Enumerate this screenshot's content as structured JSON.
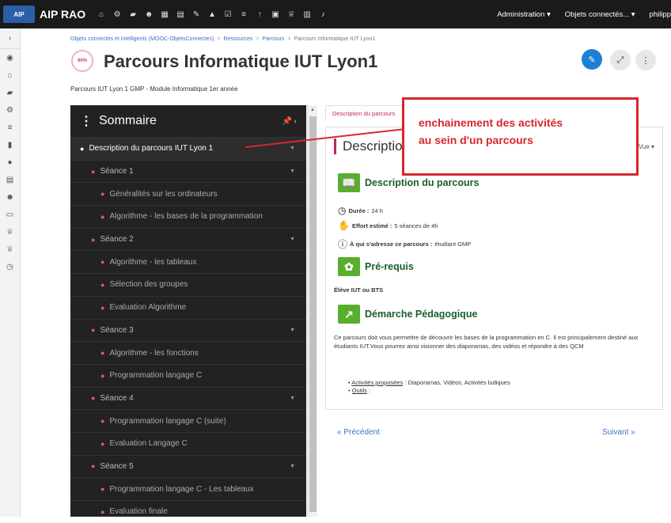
{
  "topbar": {
    "logo_text": "AIP",
    "app_title": "AIP RAO",
    "icons": [
      "home-icon",
      "gear-icon",
      "folder-icon",
      "users-icon",
      "grid-icon",
      "calendar-icon",
      "edit-icon",
      "warning-icon",
      "check-icon",
      "list-icon",
      "up-icon",
      "table-icon",
      "trophy-icon",
      "db-icon",
      "bell-icon"
    ],
    "menu_admin": "Administration ▾",
    "menu_objets": "Objets connectés... ▾",
    "menu_user": "philipp"
  },
  "breadcrumb": {
    "items": [
      "Objets connectés et intelligents (MOOC-ObjetsConnectes)",
      "Ressources",
      "Parcours",
      "Parcours Informatique IUT Lyon1"
    ]
  },
  "header": {
    "progress": "90%",
    "title": "Parcours Informatique IUT Lyon1",
    "subtitle": "Parcours IUT Lyon 1  GMP - Module Informatique 1er année"
  },
  "sommaire": {
    "title": "Sommaire",
    "items": [
      {
        "label": "Description du parcours IUT Lyon 1",
        "level": 0
      },
      {
        "label": "Séance 1",
        "level": 1
      },
      {
        "label": "Généralités sur les ordinateurs",
        "level": 2
      },
      {
        "label": "Algorithme - les bases de la programmation",
        "level": 2
      },
      {
        "label": "Séance 2",
        "level": 1
      },
      {
        "label": "Algorithme - les tableaux",
        "level": 2
      },
      {
        "label": "Sélection des groupes",
        "level": 2
      },
      {
        "label": "Evaluation Algorithme",
        "level": 2
      },
      {
        "label": "Séance 3",
        "level": 1
      },
      {
        "label": "Algorithme - les fonctions",
        "level": 2
      },
      {
        "label": "Programmation langage C",
        "level": 2
      },
      {
        "label": "Séance 4",
        "level": 1
      },
      {
        "label": "Programmation langage C (suite)",
        "level": 2
      },
      {
        "label": "Evaluation Langage C",
        "level": 2
      },
      {
        "label": "Séance 5",
        "level": 1
      },
      {
        "label": "Programmation langage C - Les tableaux",
        "level": 2
      },
      {
        "label": "Evaluation finale",
        "level": 2
      }
    ]
  },
  "content": {
    "tab_label": "Description du parcours",
    "title": "Descriptio",
    "vue": "Vue ▾",
    "section1": "Description du parcours",
    "duree_label": "Durée :",
    "duree_value": "24 h",
    "effort_label": "Effort estimé :",
    "effort_value": "5 séances de 4h",
    "public_label": "À qui s'adresse ce parcours :",
    "public_value": "étudiant GMP",
    "section2": "Pré-requis",
    "prerequis": "Élève IUT ou BTS",
    "section3": "Démarche Pédagogique",
    "paragraph": "Ce parcours doit vous permettre de découvrir les bases de la programmation en C. Il est principalement destiné aux étudiants IUT.Vous pourrez ainsi visionner des diaporamas, des vidéos et répondre à des QCM",
    "bullet1_link": "Activités proposées",
    "bullet1_text": " : Diaporamas, Vidéos,  Activités ludiques",
    "bullet2_link": "Outils",
    "bullet2_text": " :"
  },
  "nav": {
    "prev": "« Précédent",
    "next": "Suivant »"
  },
  "callout": {
    "line1": "enchainement des activités",
    "line2": "au sein d'un parcours"
  }
}
